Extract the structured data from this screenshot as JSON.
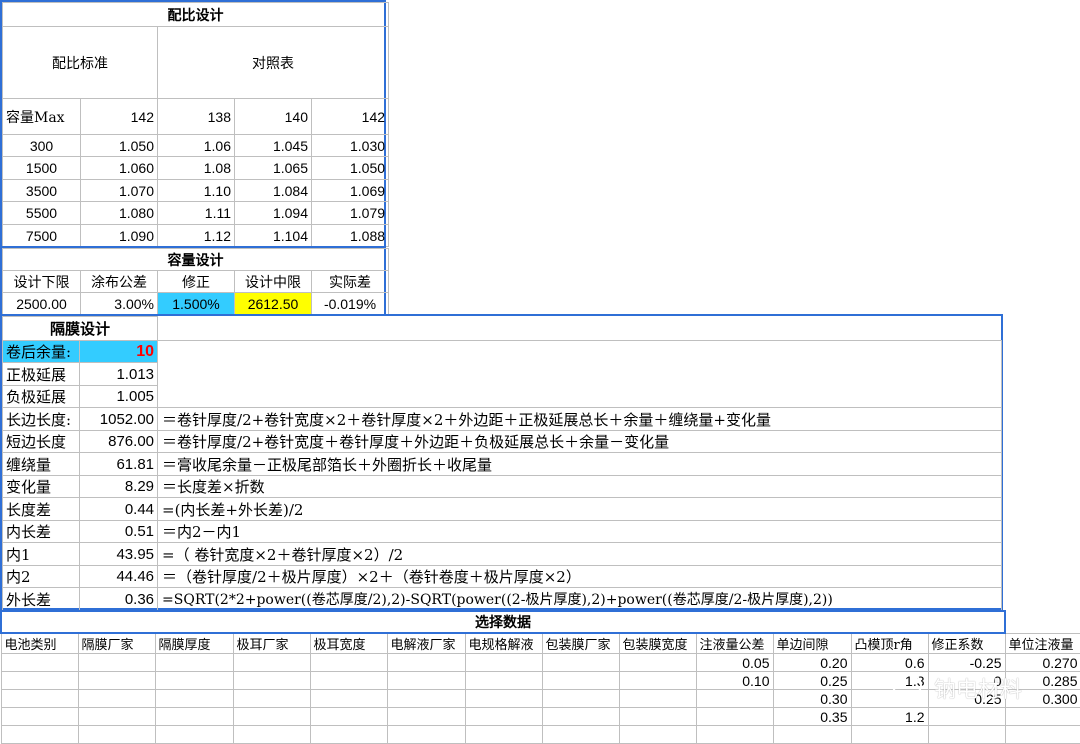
{
  "ratio": {
    "title": "配比设计",
    "standard_label": "配比标准",
    "table_label": "对照表",
    "capacity_label": "容量Max",
    "header_values": [
      "142",
      "138",
      "140",
      "142"
    ],
    "rows": [
      [
        "300",
        "1.050",
        "1.06",
        "1.045",
        "1.030"
      ],
      [
        "1500",
        "1.060",
        "1.08",
        "1.065",
        "1.050"
      ],
      [
        "3500",
        "1.070",
        "1.10",
        "1.084",
        "1.069"
      ],
      [
        "5500",
        "1.080",
        "1.11",
        "1.094",
        "1.079"
      ],
      [
        "7500",
        "1.090",
        "1.12",
        "1.104",
        "1.088"
      ]
    ]
  },
  "capacity": {
    "title": "容量设计",
    "headers": [
      "设计下限",
      "涂布公差",
      "修正",
      "设计中限",
      "实际差"
    ],
    "values": [
      "2500.00",
      "3.00%",
      "1.500%",
      "2612.50",
      "-0.019%"
    ]
  },
  "separator": {
    "title": "隔膜设计",
    "rows": [
      {
        "label": "卷后余量:",
        "value": "10",
        "formula": ""
      },
      {
        "label": "正极延展",
        "value": "1.013",
        "formula": ""
      },
      {
        "label": "负极延展",
        "value": "1.005",
        "formula": ""
      },
      {
        "label": "长边长度:",
        "value": "1052.00",
        "formula": "＝卷针厚度/2+卷针宽度×2＋卷针厚度×2＋外边距＋正极延展总长＋余量＋缠绕量+变化量"
      },
      {
        "label": "短边长度",
        "value": "876.00",
        "formula": "＝卷针厚度/2+卷针宽度＋卷针厚度＋外边距＋负极延展总长＋余量－变化量"
      },
      {
        "label": "缠绕量",
        "value": "61.81",
        "formula": "＝膏收尾余量－正极尾部箔长＋外圈折长＋收尾量"
      },
      {
        "label": "变化量",
        "value": "8.29",
        "formula": "＝长度差×折数"
      },
      {
        "label": "长度差",
        "value": "0.44",
        "formula": "=(内长差+外长差)/2"
      },
      {
        "label": "内长差",
        "value": "0.51",
        "formula": "＝内2－内1"
      },
      {
        "label": "内1",
        "value": "43.95",
        "formula": "=（ 卷针宽度×2＋卷针厚度×2）/2"
      },
      {
        "label": "内2",
        "value": "44.46",
        "formula": "＝（卷针厚度/2＋极片厚度）×2＋（卷针卷度＋极片厚度×2）"
      },
      {
        "label": "外长差",
        "value": "0.36",
        "formula": "=SQRT(2*2+power((卷芯厚度/2),2)-SQRT(power((2-极片厚度),2)+power((卷芯厚度/2-极片厚度),2))"
      }
    ]
  },
  "select": {
    "title": "选择数据",
    "headers": [
      "电池类别",
      "隔膜厂家",
      "隔膜厚度",
      "极耳厂家",
      "极耳宽度",
      "电解液厂家",
      "电规格解液",
      "包装膜厂家",
      "包装膜宽度",
      "注液量公差",
      "单边间隙",
      "凸模顶r角",
      "修正系数",
      "单位注液量"
    ],
    "rows": [
      [
        "",
        "",
        "",
        "",
        "",
        "",
        "",
        "",
        "",
        "0.05",
        "0.20",
        "0.6",
        "-0.25",
        "0.270"
      ],
      [
        "",
        "",
        "",
        "",
        "",
        "",
        "",
        "",
        "",
        "0.10",
        "0.25",
        "1.3",
        "0",
        "0.285"
      ],
      [
        "",
        "",
        "",
        "",
        "",
        "",
        "",
        "",
        "",
        "",
        "0.30",
        "",
        "0.25",
        "0.300"
      ],
      [
        "",
        "",
        "",
        "",
        "",
        "",
        "",
        "",
        "",
        "",
        "0.35",
        "1.2",
        "",
        ""
      ],
      [
        "",
        "",
        "",
        "",
        "",
        "",
        "",
        "",
        "",
        "",
        "",
        "",
        "",
        ""
      ]
    ]
  },
  "watermark": {
    "text": "钠电材料",
    "icon": "wechat-icon"
  },
  "colors": {
    "cyan": "#33ccff",
    "yellow": "#ffff00",
    "red": "#ff0000",
    "frame_blue": "#2f6fd6"
  }
}
